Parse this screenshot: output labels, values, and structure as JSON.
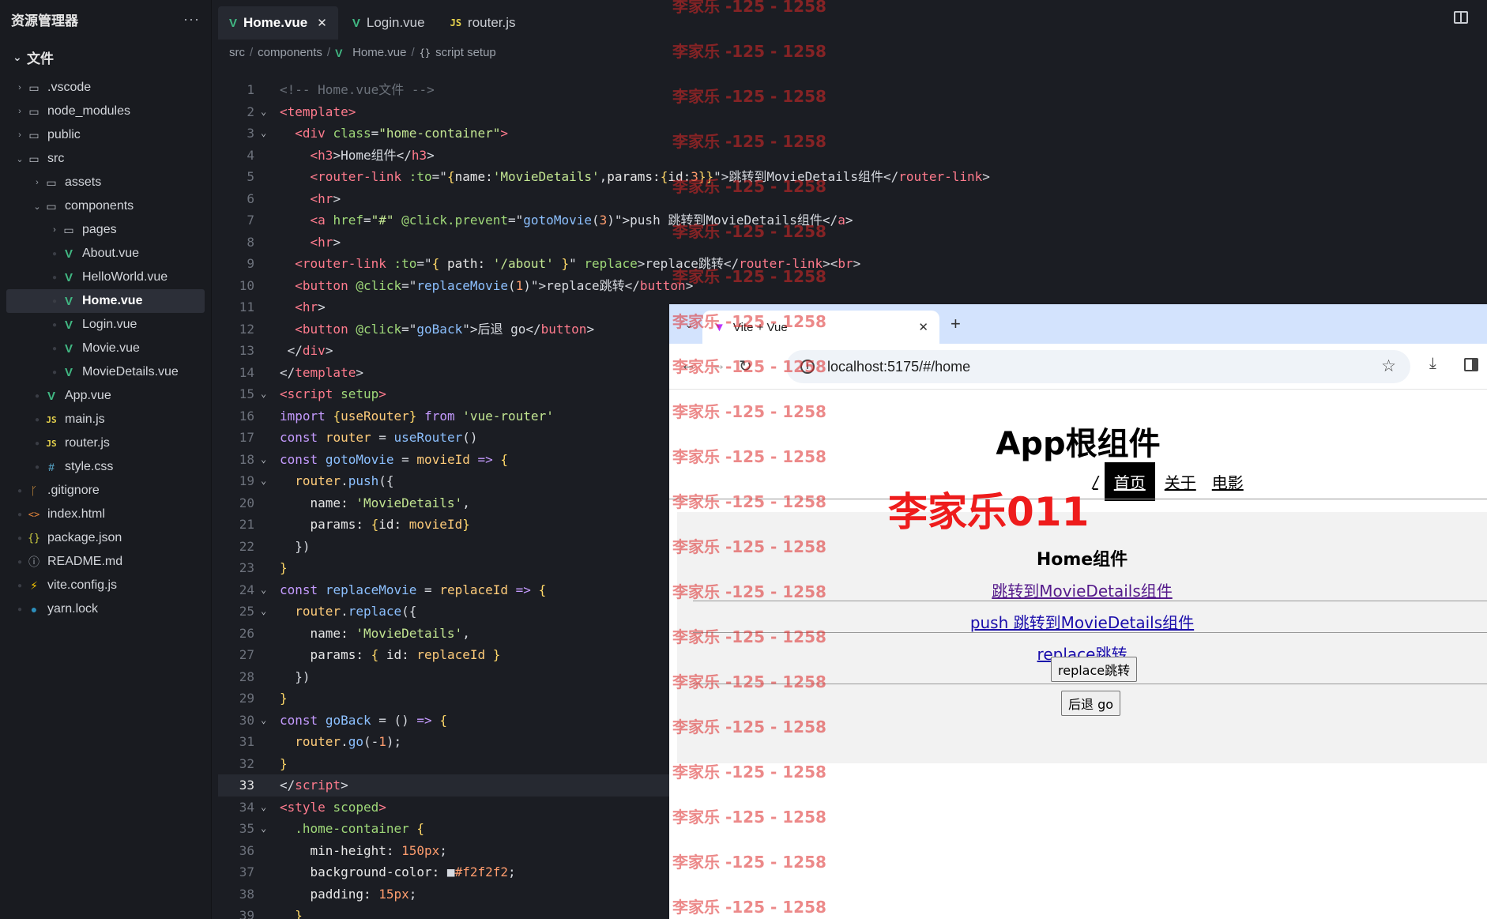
{
  "sidebar": {
    "title": "资源管理器",
    "more": "···",
    "section": "文件",
    "items": [
      {
        "label": ".vscode",
        "icon": "folder-icon",
        "level": 0,
        "type": "folder",
        "expanded": false
      },
      {
        "label": "node_modules",
        "icon": "folder-icon",
        "level": 0,
        "type": "folder",
        "expanded": false
      },
      {
        "label": "public",
        "icon": "folder-icon",
        "level": 0,
        "type": "folder",
        "expanded": false
      },
      {
        "label": "src",
        "icon": "folder-open-icon",
        "level": 0,
        "type": "folder",
        "expanded": true
      },
      {
        "label": "assets",
        "icon": "folder-icon",
        "level": 1,
        "type": "folder",
        "expanded": false
      },
      {
        "label": "components",
        "icon": "folder-open-icon",
        "level": 1,
        "type": "folder",
        "expanded": true
      },
      {
        "label": "pages",
        "icon": "folder-icon",
        "level": 2,
        "type": "folder",
        "expanded": false
      },
      {
        "label": "About.vue",
        "icon": "vue-icon",
        "level": 2,
        "type": "file"
      },
      {
        "label": "HelloWorld.vue",
        "icon": "vue-icon",
        "level": 2,
        "type": "file"
      },
      {
        "label": "Home.vue",
        "icon": "vue-icon",
        "level": 2,
        "type": "file",
        "active": true
      },
      {
        "label": "Login.vue",
        "icon": "vue-icon",
        "level": 2,
        "type": "file"
      },
      {
        "label": "Movie.vue",
        "icon": "vue-icon",
        "level": 2,
        "type": "file"
      },
      {
        "label": "MovieDetails.vue",
        "icon": "vue-icon",
        "level": 2,
        "type": "file"
      },
      {
        "label": "App.vue",
        "icon": "vue-icon",
        "level": 1,
        "type": "file"
      },
      {
        "label": "main.js",
        "icon": "js-icon",
        "level": 1,
        "type": "file"
      },
      {
        "label": "router.js",
        "icon": "js-icon",
        "level": 1,
        "type": "file"
      },
      {
        "label": "style.css",
        "icon": "css-icon",
        "level": 1,
        "type": "file"
      },
      {
        "label": ".gitignore",
        "icon": "git-icon",
        "level": 0,
        "type": "file"
      },
      {
        "label": "index.html",
        "icon": "html-icon",
        "level": 0,
        "type": "file"
      },
      {
        "label": "package.json",
        "icon": "json-icon",
        "level": 0,
        "type": "file"
      },
      {
        "label": "README.md",
        "icon": "info-icon",
        "level": 0,
        "type": "file"
      },
      {
        "label": "vite.config.js",
        "icon": "vite-icon",
        "level": 0,
        "type": "file"
      },
      {
        "label": "yarn.lock",
        "icon": "yarn-icon",
        "level": 0,
        "type": "file"
      }
    ]
  },
  "editor": {
    "tabs": [
      {
        "label": "Home.vue",
        "icon": "vue-icon",
        "active": true,
        "close": "✕"
      },
      {
        "label": "Login.vue",
        "icon": "vue-icon",
        "active": false
      },
      {
        "label": "router.js",
        "icon": "js-icon",
        "active": false
      }
    ],
    "breadcrumb": [
      "src",
      "components",
      "Home.vue",
      "script setup"
    ],
    "current_line": 33,
    "lines": [
      [
        [
          "c",
          "<!-- Home.vue文件 -->"
        ]
      ],
      [
        [
          "tag",
          "<template"
        ],
        [
          "tag",
          ">"
        ]
      ],
      [
        [
          "p",
          "  "
        ],
        [
          "tag",
          "<div"
        ],
        [
          "p",
          " "
        ],
        [
          "an",
          "class"
        ],
        [
          "p",
          "="
        ],
        [
          "s",
          "\"home-container\""
        ],
        [
          "tag",
          ">"
        ]
      ],
      [
        [
          "p",
          "    "
        ],
        [
          "tag",
          "<h3"
        ],
        [
          "p",
          ">Home组件</"
        ],
        [
          "tag",
          "h3"
        ],
        [
          "p",
          ">"
        ]
      ],
      [
        [
          "p",
          "    "
        ],
        [
          "tag",
          "<router-link"
        ],
        [
          "p",
          " "
        ],
        [
          "an",
          ":to"
        ],
        [
          "p",
          "=\""
        ],
        [
          "b",
          "{"
        ],
        [
          "pr",
          "name:"
        ],
        [
          "s",
          "'MovieDetails'"
        ],
        [
          "p",
          ","
        ],
        [
          "pr",
          "params:"
        ],
        [
          "b",
          "{"
        ],
        [
          "pr",
          "id:"
        ],
        [
          "n",
          "3"
        ],
        [
          "b",
          "}}"
        ],
        [
          "p",
          "\">跳转到MovieDetails组件</"
        ],
        [
          "tag",
          "router-link"
        ],
        [
          "p",
          ">"
        ]
      ],
      [
        [
          "p",
          "    "
        ],
        [
          "tag",
          "<hr"
        ],
        [
          "p",
          ">"
        ]
      ],
      [
        [
          "p",
          "    "
        ],
        [
          "tag",
          "<a"
        ],
        [
          "p",
          " "
        ],
        [
          "an",
          "href"
        ],
        [
          "p",
          "="
        ],
        [
          "s",
          "\"#\""
        ],
        [
          "p",
          " "
        ],
        [
          "an",
          "@click.prevent"
        ],
        [
          "p",
          "=\""
        ],
        [
          "fn",
          "gotoMovie"
        ],
        [
          "p",
          "("
        ],
        [
          "n",
          "3"
        ],
        [
          "p",
          ")\">push 跳转到MovieDetails组件</"
        ],
        [
          "tag",
          "a"
        ],
        [
          "p",
          ">"
        ]
      ],
      [
        [
          "p",
          "    "
        ],
        [
          "tag",
          "<hr"
        ],
        [
          "p",
          ">"
        ]
      ],
      [
        [
          "p",
          "  "
        ],
        [
          "tag",
          "<router-link"
        ],
        [
          "p",
          " "
        ],
        [
          "an",
          ":to"
        ],
        [
          "p",
          "=\""
        ],
        [
          "b",
          "{"
        ],
        [
          "pr",
          " path: "
        ],
        [
          "s",
          "'/about'"
        ],
        [
          "b",
          " }"
        ],
        [
          "p",
          "\" "
        ],
        [
          "an",
          "replace"
        ],
        [
          "p",
          ">replace跳转</"
        ],
        [
          "tag",
          "router-link"
        ],
        [
          "p",
          "><"
        ],
        [
          "tag",
          "br"
        ],
        [
          "p",
          ">"
        ]
      ],
      [
        [
          "p",
          "  "
        ],
        [
          "tag",
          "<button"
        ],
        [
          "p",
          " "
        ],
        [
          "an",
          "@click"
        ],
        [
          "p",
          "=\""
        ],
        [
          "fn",
          "replaceMovie"
        ],
        [
          "p",
          "("
        ],
        [
          "n",
          "1"
        ],
        [
          "p",
          ")\">replace跳转</"
        ],
        [
          "tag",
          "button"
        ],
        [
          "p",
          ">"
        ]
      ],
      [
        [
          "p",
          "  "
        ],
        [
          "tag",
          "<hr"
        ],
        [
          "p",
          ">"
        ]
      ],
      [
        [
          "p",
          "  "
        ],
        [
          "tag",
          "<button"
        ],
        [
          "p",
          " "
        ],
        [
          "an",
          "@click"
        ],
        [
          "p",
          "=\""
        ],
        [
          "fn",
          "goBack"
        ],
        [
          "p",
          "\">后退 go</"
        ],
        [
          "tag",
          "button"
        ],
        [
          "p",
          ">"
        ]
      ],
      [
        [
          "p",
          " </"
        ],
        [
          "tag",
          "div"
        ],
        [
          "p",
          ">"
        ]
      ],
      [
        [
          "p",
          "</"
        ],
        [
          "tag",
          "template"
        ],
        [
          "p",
          ">"
        ]
      ],
      [
        [
          "tag",
          "<script"
        ],
        [
          "p",
          " "
        ],
        [
          "an",
          "setup"
        ],
        [
          "tag",
          ">"
        ]
      ],
      [
        [
          "kw",
          "import"
        ],
        [
          "p",
          " "
        ],
        [
          "b",
          "{"
        ],
        [
          "v",
          "useRouter"
        ],
        [
          "b",
          "}"
        ],
        [
          "p",
          " "
        ],
        [
          "kw",
          "from"
        ],
        [
          "p",
          " "
        ],
        [
          "s",
          "'vue-router'"
        ]
      ],
      [
        [
          "kw",
          "const"
        ],
        [
          "p",
          " "
        ],
        [
          "v",
          "router"
        ],
        [
          "p",
          " = "
        ],
        [
          "fn",
          "useRouter"
        ],
        [
          "p",
          "()"
        ]
      ],
      [
        [
          "kw",
          "const"
        ],
        [
          "p",
          " "
        ],
        [
          "fn",
          "gotoMovie"
        ],
        [
          "p",
          " = "
        ],
        [
          "v",
          "movieId"
        ],
        [
          "p",
          " "
        ],
        [
          "kw",
          "=>"
        ],
        [
          "p",
          " "
        ],
        [
          "b",
          "{"
        ]
      ],
      [
        [
          "p",
          "  "
        ],
        [
          "v",
          "router"
        ],
        [
          "p",
          "."
        ],
        [
          "fn",
          "push"
        ],
        [
          "p",
          "({"
        ]
      ],
      [
        [
          "p",
          "    "
        ],
        [
          "pr",
          "name: "
        ],
        [
          "s",
          "'MovieDetails'"
        ],
        [
          "p",
          ","
        ]
      ],
      [
        [
          "p",
          "    "
        ],
        [
          "pr",
          "params: "
        ],
        [
          "b",
          "{"
        ],
        [
          "pr",
          "id: "
        ],
        [
          "v",
          "movieId"
        ],
        [
          "b",
          "}"
        ]
      ],
      [
        [
          "p",
          "  })"
        ]
      ],
      [
        [
          "b",
          "}"
        ]
      ],
      [
        [
          "kw",
          "const"
        ],
        [
          "p",
          " "
        ],
        [
          "fn",
          "replaceMovie"
        ],
        [
          "p",
          " = "
        ],
        [
          "v",
          "replaceId"
        ],
        [
          "p",
          " "
        ],
        [
          "kw",
          "=>"
        ],
        [
          "p",
          " "
        ],
        [
          "b",
          "{"
        ]
      ],
      [
        [
          "p",
          "  "
        ],
        [
          "v",
          "router"
        ],
        [
          "p",
          "."
        ],
        [
          "fn",
          "replace"
        ],
        [
          "p",
          "({"
        ]
      ],
      [
        [
          "p",
          "    "
        ],
        [
          "pr",
          "name: "
        ],
        [
          "s",
          "'MovieDetails'"
        ],
        [
          "p",
          ","
        ]
      ],
      [
        [
          "p",
          "    "
        ],
        [
          "pr",
          "params: "
        ],
        [
          "b",
          "{"
        ],
        [
          "pr",
          " id: "
        ],
        [
          "v",
          "replaceId"
        ],
        [
          "b",
          " }"
        ]
      ],
      [
        [
          "p",
          "  })"
        ]
      ],
      [
        [
          "b",
          "}"
        ]
      ],
      [
        [
          "kw",
          "const"
        ],
        [
          "p",
          " "
        ],
        [
          "fn",
          "goBack"
        ],
        [
          "p",
          " = () "
        ],
        [
          "kw",
          "=>"
        ],
        [
          "p",
          " "
        ],
        [
          "b",
          "{"
        ]
      ],
      [
        [
          "p",
          "  "
        ],
        [
          "v",
          "router"
        ],
        [
          "p",
          "."
        ],
        [
          "fn",
          "go"
        ],
        [
          "p",
          "(-"
        ],
        [
          "n",
          "1"
        ],
        [
          "p",
          ");"
        ]
      ],
      [
        [
          "b",
          "}"
        ]
      ],
      [
        [
          "p",
          "</"
        ],
        [
          "tag",
          "script"
        ],
        [
          "p",
          ">"
        ]
      ],
      [
        [
          "tag",
          "<style"
        ],
        [
          "p",
          " "
        ],
        [
          "an",
          "scoped"
        ],
        [
          "tag",
          ">"
        ]
      ],
      [
        [
          "p",
          "  "
        ],
        [
          "an",
          ".home-container"
        ],
        [
          "p",
          " "
        ],
        [
          "b",
          "{"
        ]
      ],
      [
        [
          "p",
          "    "
        ],
        [
          "pr",
          "min-height: "
        ],
        [
          "n",
          "150px"
        ],
        [
          "p",
          ";"
        ]
      ],
      [
        [
          "p",
          "    "
        ],
        [
          "pr",
          "background-color: "
        ],
        [
          "p",
          "■"
        ],
        [
          "n",
          "#f2f2f2"
        ],
        [
          "p",
          ";"
        ]
      ],
      [
        [
          "p",
          "    "
        ],
        [
          "pr",
          "padding: "
        ],
        [
          "n",
          "15px"
        ],
        [
          "p",
          ";"
        ]
      ],
      [
        [
          "p",
          "  "
        ],
        [
          "b",
          "}"
        ]
      ]
    ]
  },
  "browser": {
    "tab_title": "Vite + Vue",
    "tab_close": "✕",
    "new_tab": "+",
    "url": "localhost:5175/#/home",
    "app_title": "App根组件",
    "nav_links": [
      "/",
      "首页",
      "关于",
      "电影"
    ],
    "active_nav": "首页",
    "home_title": "Home组件",
    "link_details": "跳转到MovieDetails组件",
    "link_push": "push 跳转到MovieDetails组件",
    "link_replace": "replace跳转",
    "btn_replace": "replace跳转",
    "btn_back": "后退 go"
  },
  "watermark": {
    "text": "李家乐 -125 - 1258",
    "big_text": "李家乐011"
  },
  "colors": {
    "editor_bg": "#1b1d23",
    "sidebar_bg": "#191b20",
    "vue_green": "#41b883",
    "browser_tabbar": "#d3e3fd",
    "watermark_red": "#ee1c1c"
  }
}
